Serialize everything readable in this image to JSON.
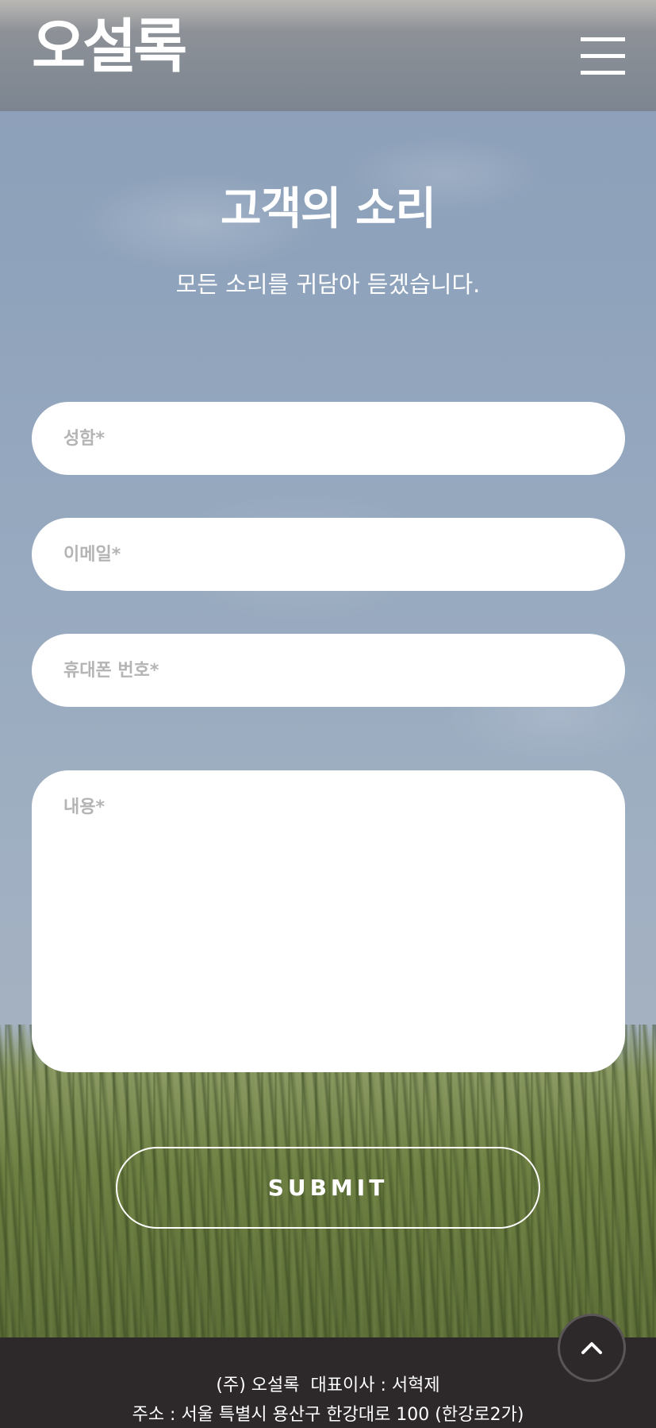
{
  "header": {
    "logo_text": "오설록",
    "menu_icon": "hamburger-menu-icon"
  },
  "main": {
    "title": "고객의 소리",
    "subtitle": "모든 소리를 귀담아 듣겠습니다."
  },
  "form": {
    "name_placeholder": "성함*",
    "email_placeholder": "이메일*",
    "phone_placeholder": "휴대폰 번호*",
    "content_placeholder": "내용*",
    "submit_label": "SUBMIT"
  },
  "footer": {
    "company_line": "(주) 오설록  대표이사 : 서혁제",
    "address_line": "주소 : 서울 특별시 용산구 한강대로 100 (한강로2가)"
  },
  "scroll_top": {
    "icon": "chevron-up-icon"
  },
  "colors": {
    "footer_bg": "#2d2829",
    "input_bg": "#ffffff",
    "placeholder": "#b4b4b4",
    "text": "#ffffff"
  }
}
